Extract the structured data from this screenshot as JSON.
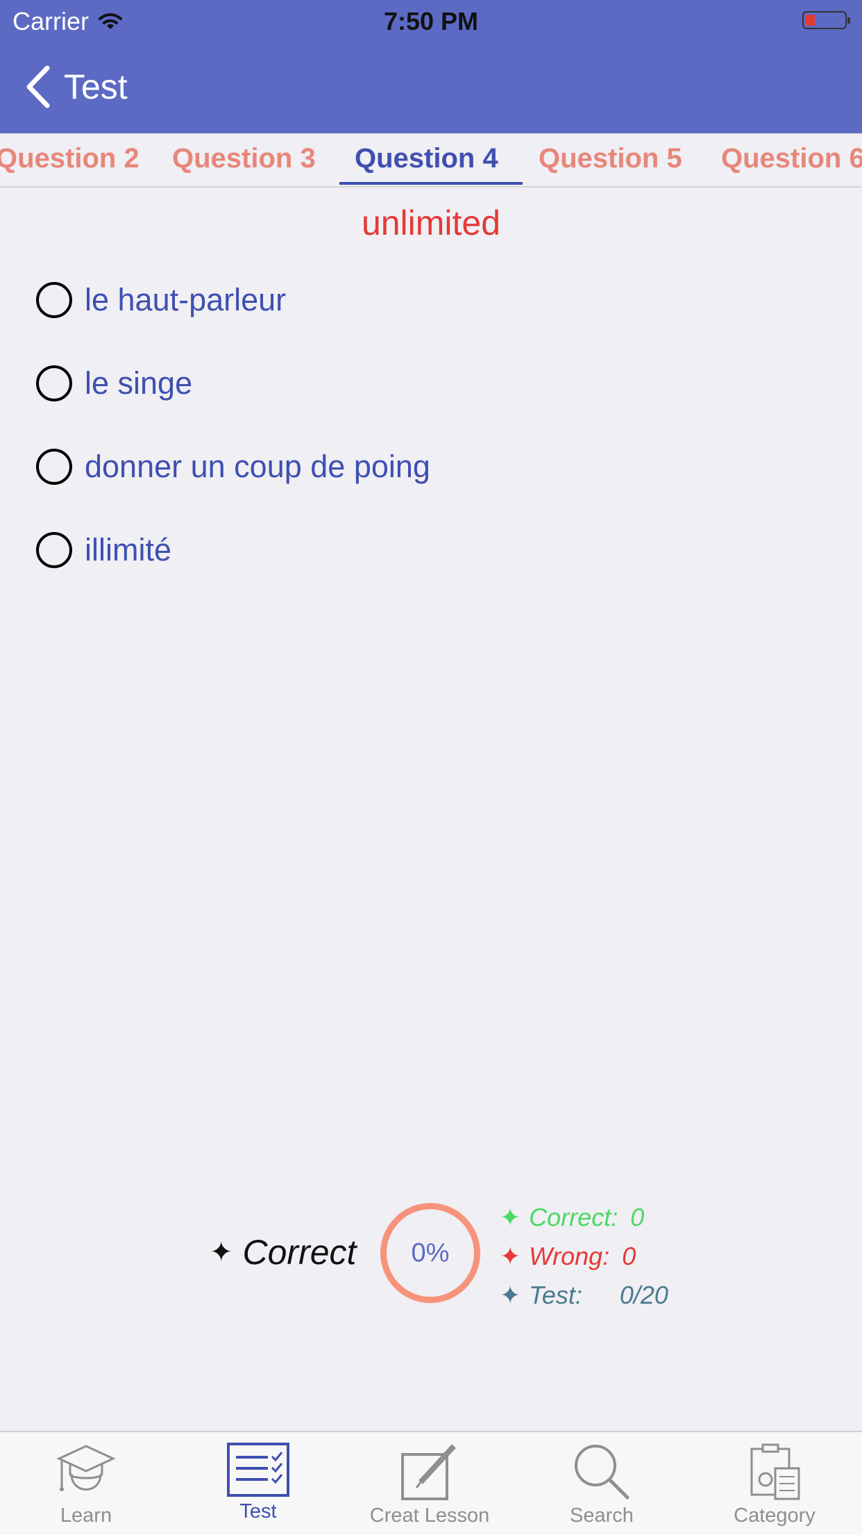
{
  "status_bar": {
    "carrier": "Carrier",
    "time": "7:50 PM",
    "battery_color": "#e53935"
  },
  "nav": {
    "title": "Test",
    "back_icon": "chevron-left-icon",
    "background": "#5c6ac4"
  },
  "tabs": [
    {
      "label": "Question 2"
    },
    {
      "label": "Question 3"
    },
    {
      "label": "Question 4",
      "active": true
    },
    {
      "label": "Question 5"
    },
    {
      "label": "Question 6"
    }
  ],
  "question": {
    "word": "unlimited",
    "options": [
      {
        "label": "le haut-parleur"
      },
      {
        "label": "le singe"
      },
      {
        "label": "donner un coup de poing"
      },
      {
        "label": "illimité"
      }
    ]
  },
  "stats": {
    "star": "✦",
    "correct_title": "Correct",
    "percent": "0%",
    "correct_label": "Correct:",
    "correct_value": "0",
    "wrong_label": "Wrong:",
    "wrong_value": "0",
    "test_label": "Test:",
    "test_value": "0/20",
    "colors": {
      "correct": "#4cd964",
      "wrong": "#e53935",
      "test": "#4a7b8c",
      "ring": "#f7937b"
    }
  },
  "tabbar": {
    "items": [
      {
        "label": "Learn",
        "icon": "graduate-icon"
      },
      {
        "label": "Test",
        "icon": "checklist-icon",
        "active": true
      },
      {
        "label": "Creat Lesson",
        "icon": "edit-icon"
      },
      {
        "label": "Search",
        "icon": "search-icon"
      },
      {
        "label": "Category",
        "icon": "calculator-icon"
      }
    ]
  }
}
